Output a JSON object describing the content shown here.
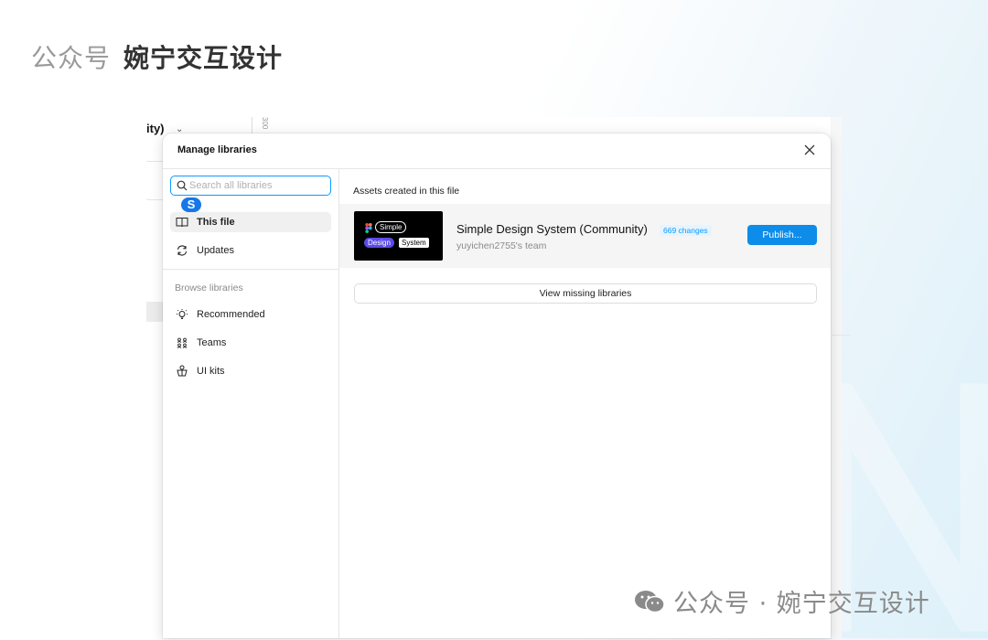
{
  "header": {
    "prefix": "公众号",
    "title": "婉宁交互设计"
  },
  "background_app": {
    "partial_text": "ity)",
    "ruler_text": "300"
  },
  "dialog": {
    "title": "Manage libraries",
    "close_icon": "close-icon",
    "search": {
      "placeholder": "Search all libraries",
      "value": ""
    },
    "badge_letter": "S",
    "sidebar": {
      "items": [
        {
          "label": "This file",
          "icon": "book-icon",
          "active": true
        },
        {
          "label": "Updates",
          "icon": "refresh-icon",
          "active": false
        }
      ],
      "browse_heading": "Browse libraries",
      "browse_items": [
        {
          "label": "Recommended",
          "icon": "lightbulb-icon"
        },
        {
          "label": "Teams",
          "icon": "team-icon"
        },
        {
          "label": "UI kits",
          "icon": "ui-kit-icon"
        }
      ]
    },
    "main": {
      "section_title": "Assets created in this file",
      "library": {
        "thumb_words": [
          "Simple",
          "Design",
          "System"
        ],
        "name": "Simple Design System (Community)",
        "changes": "669 changes",
        "team": "yuyichen2755's team",
        "publish_label": "Publish..."
      },
      "view_missing_label": "View missing libraries"
    }
  },
  "footer_watermark": "公众号 · 婉宁交互设计",
  "colors": {
    "accent": "#0d99ff",
    "publish": "#0d8ce9",
    "badge": "#1877e8"
  }
}
